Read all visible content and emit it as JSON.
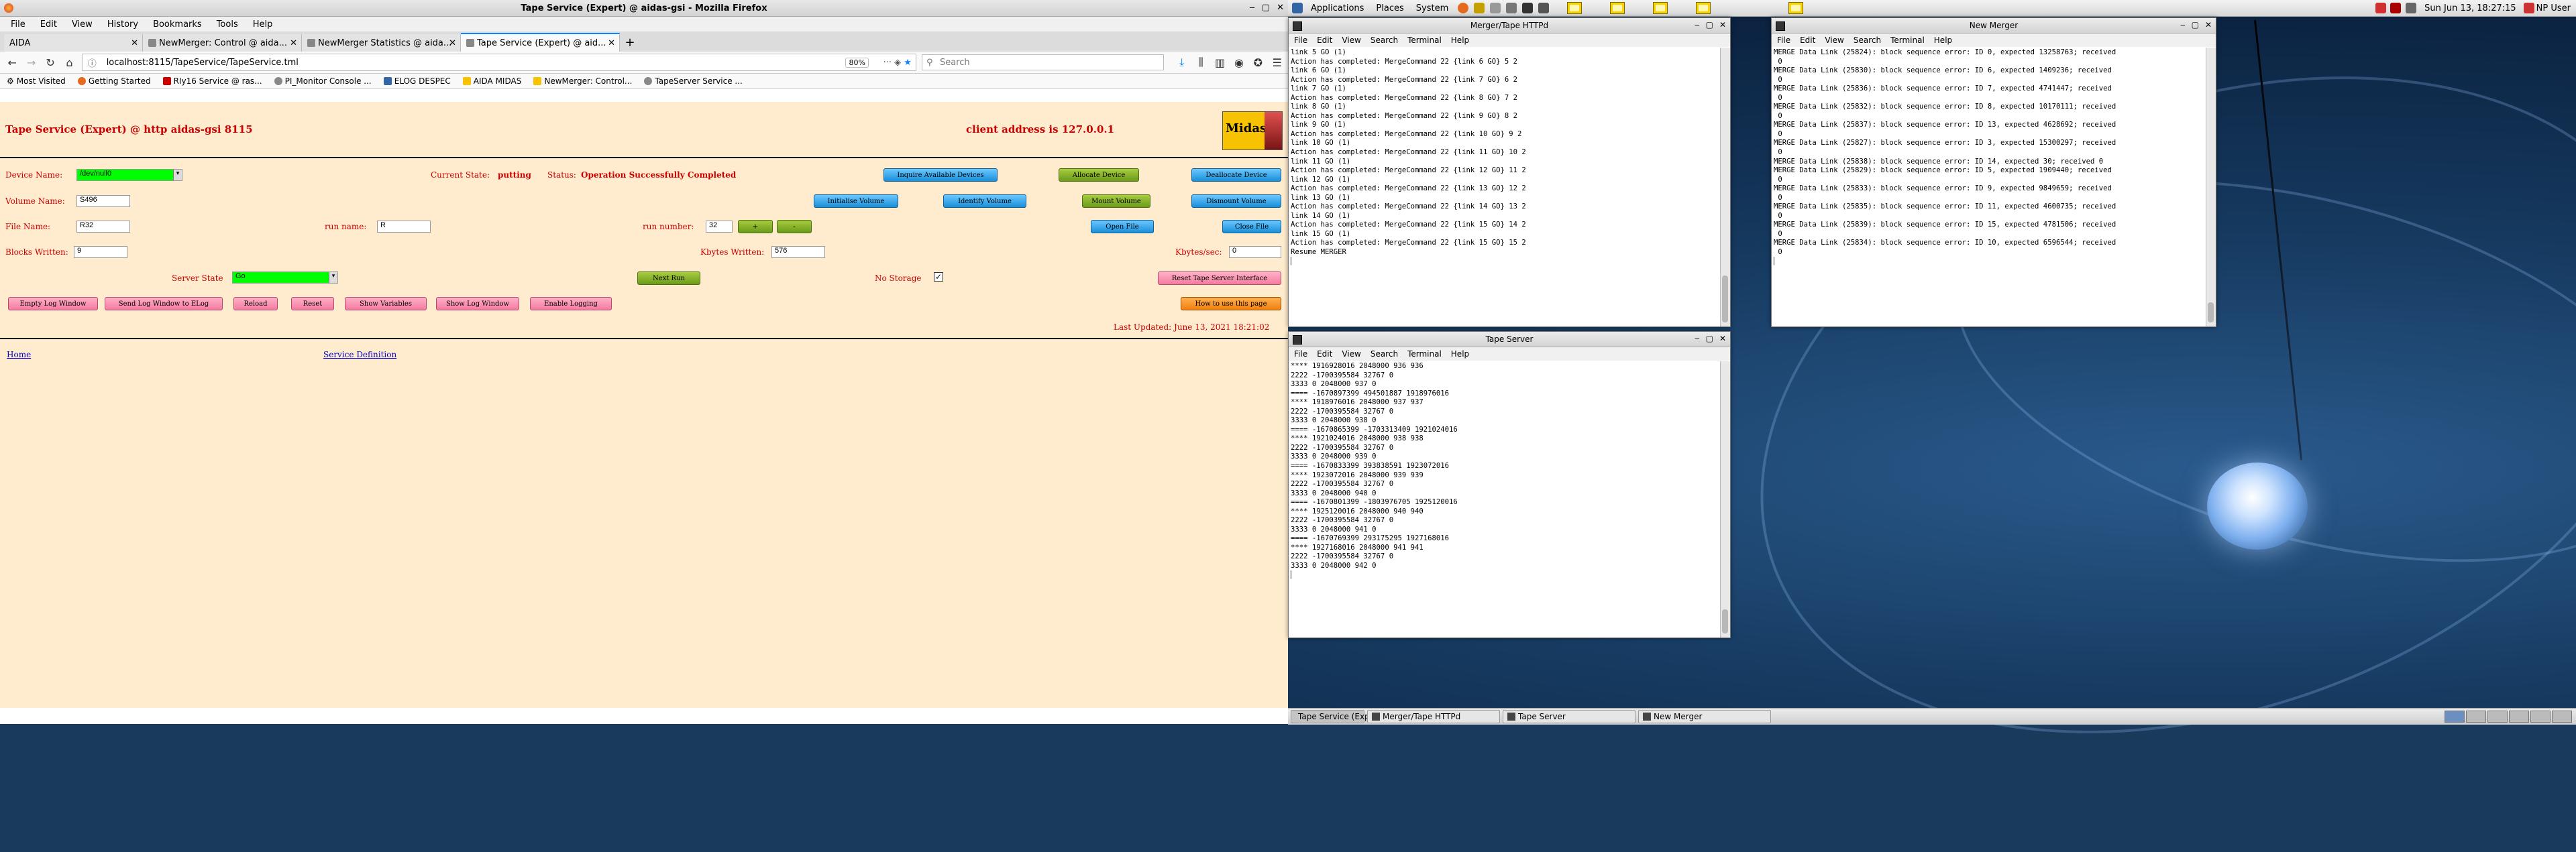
{
  "desktop": {
    "top_panel": {
      "applications": "Applications",
      "places": "Places",
      "system": "System",
      "clock": "Sun Jun 13, 18:27:15",
      "user": "NP User"
    },
    "taskbar": [
      {
        "label": "Tape Service (Expert) ...",
        "active": true
      },
      {
        "label": "Merger/Tape HTTPd",
        "active": false
      },
      {
        "label": "Tape Server",
        "active": false
      },
      {
        "label": "New Merger",
        "active": false
      }
    ]
  },
  "firefox": {
    "window_title": "Tape Service (Expert) @ aidas-gsi - Mozilla Firefox",
    "menu": [
      "File",
      "Edit",
      "View",
      "History",
      "Bookmarks",
      "Tools",
      "Help"
    ],
    "tabs": [
      {
        "label": "AIDA",
        "active": false
      },
      {
        "label": "NewMerger: Control @ aida...",
        "active": false
      },
      {
        "label": "NewMerger Statistics @ aida...",
        "active": false
      },
      {
        "label": "Tape Service (Expert) @ aid...",
        "active": true
      }
    ],
    "url": "localhost:8115/TapeService/TapeService.tml",
    "zoom": "80%",
    "search_placeholder": "Search",
    "bookmarks": [
      "Most Visited",
      "Getting Started",
      "RIy16 Service @ ras...",
      "PI_Monitor Console ...",
      "ELOG DESPEC",
      "AIDA MIDAS",
      "NewMerger: Control...",
      "TapeServer Service ..."
    ]
  },
  "page": {
    "title": "Tape Service (Expert) @ http aidas-gsi 8115",
    "client_address": "client address is 127.0.0.1",
    "logo_text": "Midas",
    "device_name_label": "Device Name:",
    "device_name_value": "/dev/null0",
    "current_state_label": "Current State:",
    "current_state_value": "putting",
    "status_label": "Status:",
    "status_value": "Operation Successfully Completed",
    "volume_name_label": "Volume Name:",
    "volume_name_value": "S496",
    "file_name_label": "File Name:",
    "file_name_value": "R32",
    "run_name_label": "run name:",
    "run_name_value": "R",
    "run_number_label": "run number:",
    "run_number_value": "32",
    "run_plus": "+",
    "run_minus": "-",
    "blocks_written_label": "Blocks Written:",
    "blocks_written_value": "9",
    "kbytes_written_label": "Kbytes Written:",
    "kbytes_written_value": "576",
    "kbytes_sec_label": "Kbytes/sec:",
    "kbytes_sec_value": "0",
    "server_state_label": "Server State",
    "server_state_value": "Go",
    "no_storage_label": "No Storage",
    "buttons": {
      "inquire": "Inquire Available Devices",
      "allocate": "Allocate Device",
      "deallocate": "Deallocate Device",
      "initialise": "Initialise Volume",
      "identify": "Identify Volume",
      "mount": "Mount Volume",
      "dismount": "Dismount Volume",
      "open_file": "Open File",
      "close_file": "Close File",
      "next_run": "Next Run",
      "reset_tape": "Reset Tape Server Interface",
      "how_to": "How to use this page",
      "empty_log": "Empty Log Window",
      "send_log": "Send Log Window to ELog",
      "reload": "Reload",
      "reset": "Reset",
      "show_variables": "Show Variables",
      "show_log": "Show Log Window",
      "enable_logging": "Enable Logging"
    },
    "last_updated": "Last Updated: June 13, 2021 18:21:02",
    "home_link": "Home",
    "service_def_link": "Service Definition"
  },
  "merger_httpd": {
    "title": "Merger/Tape HTTPd",
    "menu": [
      "File",
      "Edit",
      "View",
      "Search",
      "Terminal",
      "Help"
    ],
    "lines": [
      "link 5 GO (1)",
      "Action has completed: MergeCommand 22 {link 6 GO} 5 2",
      "link 6 GO (1)",
      "Action has completed: MergeCommand 22 {link 7 GO} 6 2",
      "link 7 GO (1)",
      "Action has completed: MergeCommand 22 {link 8 GO} 7 2",
      "link 8 GO (1)",
      "Action has completed: MergeCommand 22 {link 9 GO} 8 2",
      "link 9 GO (1)",
      "Action has completed: MergeCommand 22 {link 10 GO} 9 2",
      "link 10 GO (1)",
      "Action has completed: MergeCommand 22 {link 11 GO} 10 2",
      "link 11 GO (1)",
      "Action has completed: MergeCommand 22 {link 12 GO} 11 2",
      "link 12 GO (1)",
      "Action has completed: MergeCommand 22 {link 13 GO} 12 2",
      "link 13 GO (1)",
      "Action has completed: MergeCommand 22 {link 14 GO} 13 2",
      "link 14 GO (1)",
      "Action has completed: MergeCommand 22 {link 15 GO} 14 2",
      "link 15 GO (1)",
      "Action has completed: MergeCommand 22 {link 15 GO} 15 2",
      "Resume MERGER",
      "▏"
    ]
  },
  "new_merger": {
    "title": "New Merger",
    "menu": [
      "File",
      "Edit",
      "View",
      "Search",
      "Terminal",
      "Help"
    ],
    "lines": [
      "MERGE Data Link (25824): block sequence error: ID 0, expected 13258763; received",
      " 0",
      "MERGE Data Link (25830): block sequence error: ID 6, expected 1409236; received",
      " 0",
      "MERGE Data Link (25836): block sequence error: ID 7, expected 4741447; received",
      " 0",
      "MERGE Data Link (25832): block sequence error: ID 8, expected 10170111; received",
      " 0",
      "MERGE Data Link (25837): block sequence error: ID 13, expected 4628692; received",
      " 0",
      "MERGE Data Link (25827): block sequence error: ID 3, expected 15300297; received",
      " 0",
      "MERGE Data Link (25838): block sequence error: ID 14, expected 30; received 0",
      "MERGE Data Link (25829): block sequence error: ID 5, expected 1909440; received",
      " 0",
      "MERGE Data Link (25833): block sequence error: ID 9, expected 9849659; received",
      " 0",
      "MERGE Data Link (25835): block sequence error: ID 11, expected 4600735; received",
      " 0",
      "MERGE Data Link (25839): block sequence error: ID 15, expected 4781506; received",
      " 0",
      "MERGE Data Link (25834): block sequence error: ID 10, expected 6596544; received",
      " 0",
      "▏"
    ]
  },
  "tape_server": {
    "title": "Tape Server",
    "menu": [
      "File",
      "Edit",
      "View",
      "Search",
      "Terminal",
      "Help"
    ],
    "lines": [
      "**** 1916928016 2048000 936 936",
      "2222 -1700395584 32767 0",
      "3333 0 2048000 937 0",
      "==== -1670897399 494501887 1918976016",
      "**** 1918976016 2048000 937 937",
      "2222 -1700395584 32767 0",
      "3333 0 2048000 938 0",
      "==== -1670865399 -1703313409 1921024016",
      "**** 1921024016 2048000 938 938",
      "2222 -1700395584 32767 0",
      "3333 0 2048000 939 0",
      "==== -1670833399 393838591 1923072016",
      "**** 1923072016 2048000 939 939",
      "2222 -1700395584 32767 0",
      "3333 0 2048000 940 0",
      "==== -1670801399 -1803976705 1925120016",
      "**** 1925120016 2048000 940 940",
      "2222 -1700395584 32767 0",
      "3333 0 2048000 941 0",
      "==== -1670769399 293175295 1927168016",
      "**** 1927168016 2048000 941 941",
      "2222 -1700395584 32767 0",
      "3333 0 2048000 942 0",
      "▏"
    ]
  }
}
